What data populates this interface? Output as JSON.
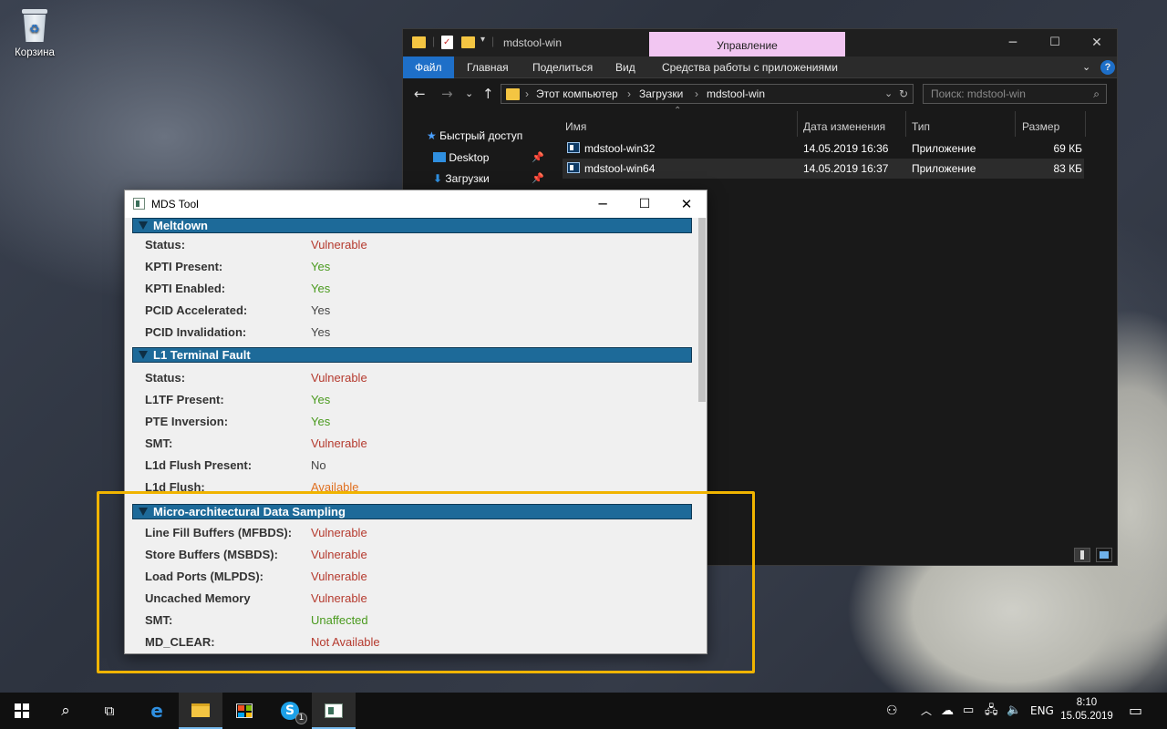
{
  "desktop": {
    "recycle_bin_label": "Корзина"
  },
  "explorer": {
    "title": "mdstool-win",
    "manage_tab": "Управление",
    "ribbon_tabs": [
      "Файл",
      "Главная",
      "Поделиться",
      "Вид",
      "Средства работы с приложениями"
    ],
    "breadcrumb": [
      "Этот компьютер",
      "Загрузки",
      "mdstool-win"
    ],
    "search_placeholder": "Поиск: mdstool-win",
    "nav": {
      "quick_access": "Быстрый доступ",
      "desktop": "Desktop",
      "downloads": "Загрузки"
    },
    "columns": {
      "name": "Имя",
      "date": "Дата изменения",
      "type": "Тип",
      "size": "Размер"
    },
    "files": [
      {
        "name": "mdstool-win32",
        "date": "14.05.2019 16:36",
        "type": "Приложение",
        "size": "69 КБ"
      },
      {
        "name": "mdstool-win64",
        "date": "14.05.2019 16:37",
        "type": "Приложение",
        "size": "83 КБ"
      }
    ],
    "accent_color": "#1e6fc8",
    "manage_color": "#f2c6f2"
  },
  "mds": {
    "title": "MDS Tool",
    "sections": [
      {
        "title": "Meltdown",
        "rows": [
          {
            "label": "Status:",
            "value": "Vulnerable",
            "state": "red"
          },
          {
            "label": "KPTI Present:",
            "value": "Yes",
            "state": "green"
          },
          {
            "label": "KPTI Enabled:",
            "value": "Yes",
            "state": "green"
          },
          {
            "label": "PCID Accelerated:",
            "value": "Yes",
            "state": "gray"
          },
          {
            "label": "PCID Invalidation:",
            "value": "Yes",
            "state": "gray"
          }
        ]
      },
      {
        "title": "L1 Terminal Fault",
        "rows": [
          {
            "label": "Status:",
            "value": "Vulnerable",
            "state": "red"
          },
          {
            "label": "L1TF Present:",
            "value": "Yes",
            "state": "green"
          },
          {
            "label": "PTE Inversion:",
            "value": "Yes",
            "state": "green"
          },
          {
            "label": "SMT:",
            "value": "Vulnerable",
            "state": "red"
          },
          {
            "label": "L1d Flush Present:",
            "value": "No",
            "state": "gray"
          },
          {
            "label": "L1d Flush:",
            "value": "Available",
            "state": "orange"
          }
        ]
      },
      {
        "title": "Micro-architectural Data Sampling",
        "rows": [
          {
            "label": "Line Fill Buffers (MFBDS):",
            "value": "Vulnerable",
            "state": "red"
          },
          {
            "label": "Store Buffers (MSBDS):",
            "value": "Vulnerable",
            "state": "red"
          },
          {
            "label": "Load Ports (MLPDS):",
            "value": "Vulnerable",
            "state": "red"
          },
          {
            "label": "Uncached Memory",
            "value": "Vulnerable",
            "state": "red"
          },
          {
            "label": "SMT:",
            "value": "Unaffected",
            "state": "green"
          },
          {
            "label": "MD_CLEAR:",
            "value": "Not Available",
            "state": "red"
          }
        ]
      }
    ],
    "header_color": "#1d6a99",
    "highlight_color": "#f0b400"
  },
  "taskbar": {
    "language": "ENG",
    "time": "8:10",
    "date": "15.05.2019",
    "skype_badge": "1"
  }
}
